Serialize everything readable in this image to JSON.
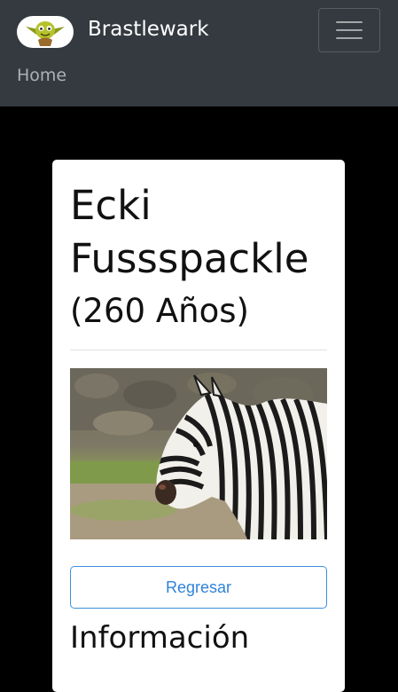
{
  "navbar": {
    "brand": "Brastlewark",
    "home_link": "Home",
    "logo_icon": "goblin-logo",
    "toggler_icon": "hamburger-menu-icon"
  },
  "profile": {
    "name": "Ecki Fussspackle",
    "age": "(260 Años)",
    "photo_subject": "zebra",
    "back_button": "Regresar",
    "info_heading": "Información"
  },
  "colors": {
    "navbar_bg": "#343a40",
    "page_bg": "#000000",
    "button_accent": "#2f83d9"
  }
}
